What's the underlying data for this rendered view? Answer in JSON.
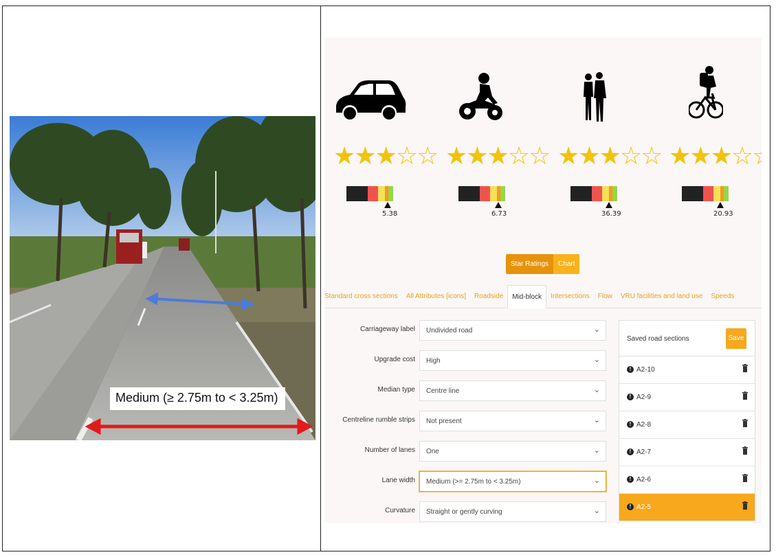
{
  "photo": {
    "overlay_label": "Medium (≥ 2.75m to < 3.25m)"
  },
  "users": [
    {
      "icon": "car-icon",
      "stars_on": 3,
      "stars_total": 5,
      "score": "5.38",
      "marker_fraction": 0.88
    },
    {
      "icon": "motorcycle-icon",
      "stars_on": 3,
      "stars_total": 5,
      "score": "6.73",
      "marker_fraction": 0.85
    },
    {
      "icon": "pedestrian-icon",
      "stars_on": 3,
      "stars_total": 5,
      "score": "36.39",
      "marker_fraction": 0.82
    },
    {
      "icon": "bicycle-icon",
      "stars_on": 3,
      "stars_total": 5,
      "score": "20.93",
      "marker_fraction": 0.83
    }
  ],
  "band_colors": [
    "#222222",
    "#ef5350",
    "#f5e05a",
    "#f29c1b",
    "#97d64b"
  ],
  "toggle": {
    "star_ratings": "Star Ratings",
    "chart": "Chart"
  },
  "tabs": [
    "Standard cross sections",
    "All Attributes [icons]",
    "Roadside",
    "Mid-block",
    "Intersections",
    "Flow",
    "VRU facilities and land use",
    "Speeds"
  ],
  "active_tab": "Mid-block",
  "form": [
    {
      "label": "Carriageway label",
      "value": "Undivided road"
    },
    {
      "label": "Upgrade cost",
      "value": "High"
    },
    {
      "label": "Median type",
      "value": "Centre line"
    },
    {
      "label": "Centreline rumble strips",
      "value": "Not present"
    },
    {
      "label": "Number of lanes",
      "value": "One"
    },
    {
      "label": "Lane width",
      "value": "Medium (>= 2.75m to < 3.25m)"
    },
    {
      "label": "Curvature",
      "value": "Straight or gently curving"
    }
  ],
  "saved": {
    "title": "Saved road sections",
    "save_label": "Save",
    "items": [
      "A2-10",
      "A2-9",
      "A2-8",
      "A2-7",
      "A2-6",
      "A2-5"
    ],
    "active_item": "A2-5"
  },
  "colors": {
    "accent": "#f7a81d",
    "star": "#f4c20d"
  }
}
